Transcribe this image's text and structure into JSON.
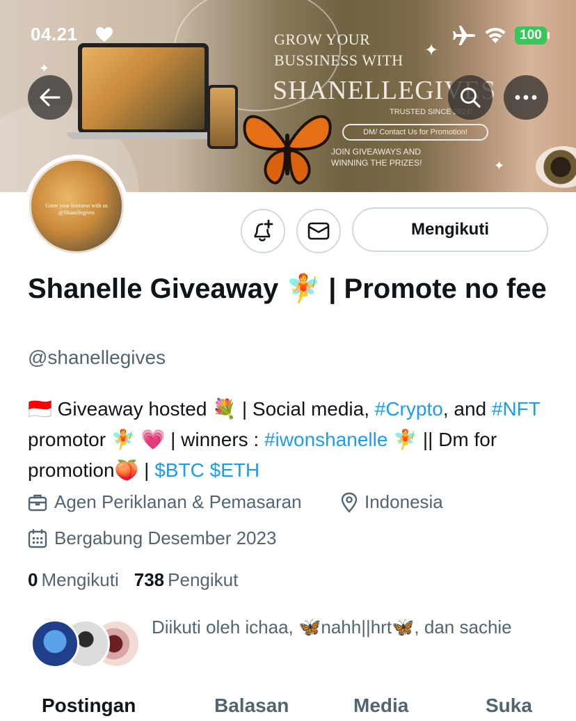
{
  "status_bar": {
    "time": "04.21",
    "battery": "100"
  },
  "banner": {
    "line1": "GROW YOUR",
    "line2": "BUSSINESS WITH",
    "brand": "SHANELLEGIVES",
    "trusted": "TRUSTED SINCE 2024!",
    "cta": "DM/ Contact Us for Promotion!",
    "giveaway": "JOIN GIVEAWAYS AND\nWINNING THE PRIZES!"
  },
  "avatar": {
    "text": "Grow your business with us @Shanellegives"
  },
  "actions": {
    "follow_label": "Mengikuti"
  },
  "profile": {
    "display_name": "Shanelle Giveaway 🧚 | Promote no fee",
    "handle": "@shanellegives",
    "bio": {
      "p1": "🇮🇩 Giveaway hosted 💐 | Social media, ",
      "tag1": "#Crypto",
      "p2": ", and ",
      "tag2": "#NFT",
      "p3": " promotor 🧚 💗 | winners : ",
      "tag3": "#iwonshanelle",
      "p4": " 🧚 || Dm for promotion🍑 | ",
      "tag4": "$BTC",
      "p5": " ",
      "tag5": "$ETH"
    },
    "category": "Agen Periklanan & Pemasaran",
    "location": "Indonesia",
    "joined": "Bergabung Desember 2023",
    "following_count": "0",
    "following_label": "Mengikuti",
    "followers_count": "738",
    "followers_label": "Pengikut",
    "followed_by": "Diikuti oleh ichaa, 🦋nahh||hrt🦋, dan sachie"
  },
  "tabs": [
    {
      "label": "Postingan",
      "active": true
    },
    {
      "label": "Balasan",
      "active": false
    },
    {
      "label": "Media",
      "active": false
    },
    {
      "label": "Suka",
      "active": false
    }
  ],
  "icons": {
    "back": "arrow-left-icon",
    "search": "search-icon",
    "more": "more-horizontal-icon",
    "notify": "bell-plus-icon",
    "message": "envelope-icon",
    "category": "briefcase-icon",
    "location": "map-pin-icon",
    "joined": "calendar-icon"
  },
  "colors": {
    "link": "#1d9bf0",
    "secondary_text": "#536471",
    "primary_text": "#0f1419",
    "battery": "#35c759"
  }
}
